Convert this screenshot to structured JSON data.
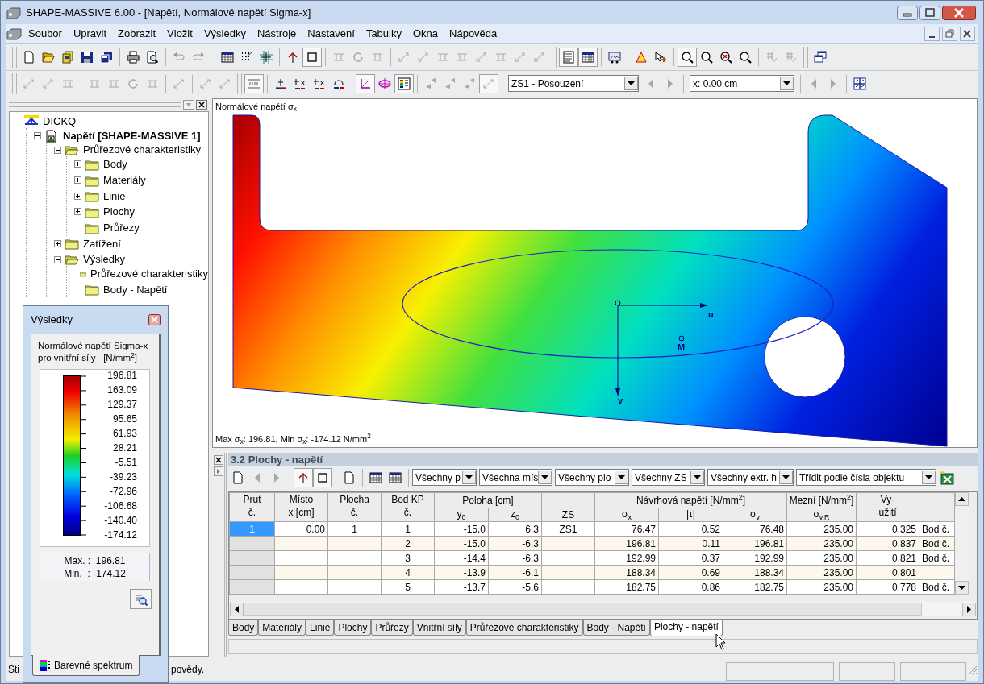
{
  "window": {
    "title": "SHAPE-MASSIVE 6.00 - [Napětí, Normálové napětí Sigma-x]"
  },
  "menu": [
    "Soubor",
    "Upravit",
    "Zobrazit",
    "Vložit",
    "Výsledky",
    "Nástroje",
    "Nastavení",
    "Tabulky",
    "Okna",
    "Nápověda"
  ],
  "toolbar": {
    "load_case": "ZS1 - Posouzení",
    "location": "x: 0.00 cm"
  },
  "navigator": {
    "tree": [
      {
        "label": "DICKQ",
        "kind": "root",
        "children": [
          {
            "label": "Napětí [SHAPE-MASSIVE 1]",
            "kind": "file",
            "expanded": true,
            "children": [
              {
                "label": "Průřezové charakteristiky",
                "kind": "folder",
                "expanded": true,
                "children": [
                  {
                    "label": "Body",
                    "kind": "folder",
                    "expanded": false
                  },
                  {
                    "label": "Materiály",
                    "kind": "folder",
                    "expanded": false
                  },
                  {
                    "label": "Linie",
                    "kind": "folder",
                    "expanded": false
                  },
                  {
                    "label": "Plochy",
                    "kind": "folder",
                    "expanded": false
                  },
                  {
                    "label": "Průřezy",
                    "kind": "leaf"
                  }
                ]
              },
              {
                "label": "Zatížení",
                "kind": "folder",
                "expanded": false
              },
              {
                "label": "Výsledky",
                "kind": "folder",
                "expanded": true,
                "children": [
                  {
                    "label": "Průřezové charakteristiky",
                    "kind": "leaf"
                  },
                  {
                    "label": "Body - Napětí",
                    "kind": "leaf"
                  }
                ]
              }
            ]
          }
        ]
      }
    ]
  },
  "graphic": {
    "title": "Normálové napětí σ$_{x}$",
    "axis_labels": [
      "u",
      "v"
    ],
    "point_label": "M",
    "summary": "Max σ$_{x}$: 196.81, Min σ$_{x}$: -174.12 N/mm$^{2}$"
  },
  "results_panel": {
    "title": "Výsledky",
    "caption": [
      "Normálové napětí Sigma-x",
      "pro vnitřní síly   [N/mm$^{2}$]"
    ],
    "scale": [
      "196.81",
      "163.09",
      "129.37",
      "95.65",
      "61.93",
      "28.21",
      "-5.51",
      "-39.23",
      "-72.96",
      "-106.68",
      "-140.40",
      "-174.12"
    ],
    "extremes": [
      "Max. :  196.81",
      "Min.  : -174.12"
    ],
    "tab": "Barevné spektrum"
  },
  "table_panel": {
    "title": "3.2 Plochy - napětí",
    "filters": [
      "Všechny p",
      "Všechna mís",
      "Všechny plo",
      "Všechny ZS",
      "Všechny extr. h",
      "Třídit podle čísla objektu"
    ],
    "columns": [
      {
        "kind": "stack",
        "lines": [
          "Prut",
          "č."
        ]
      },
      {
        "kind": "stack",
        "lines": [
          "Místo",
          "x [cm]"
        ]
      },
      {
        "kind": "stack",
        "lines": [
          "Plocha",
          "č."
        ]
      },
      {
        "kind": "stack",
        "lines": [
          "Bod KP",
          "č."
        ]
      },
      {
        "kind": "group",
        "title": "Poloha [cm]",
        "colspan": 2,
        "subs": [
          "y$_{0}$",
          "z$_{0}$"
        ]
      },
      {
        "kind": "single",
        "label": "ZS"
      },
      {
        "kind": "group",
        "title": "Návrhová napětí [N/mm$^{2}$]",
        "colspan": 3,
        "subs": [
          "σ$_{x}$",
          "|τ|",
          "σ$_{v}$"
        ]
      },
      {
        "kind": "group",
        "title": "Mezní [N/mm$^{2}$]",
        "subs": [
          "σ$_{v,R}$"
        ]
      },
      {
        "kind": "stack",
        "lines": [
          "Vy-",
          "užití"
        ]
      }
    ],
    "rows": [
      {
        "selected": true,
        "cells": [
          "1",
          "0.00",
          "1",
          "1",
          "-15.0",
          "6.3",
          "ZS1",
          "76.47",
          "0.52",
          "76.48",
          "235.00",
          "0.325",
          "Bod č."
        ]
      },
      {
        "selected": false,
        "cells": [
          null,
          null,
          null,
          "2",
          "-15.0",
          "-6.3",
          null,
          "196.81",
          "0.11",
          "196.81",
          "235.00",
          "0.837",
          "Bod č."
        ]
      },
      {
        "selected": false,
        "cells": [
          null,
          null,
          null,
          "3",
          "-14.4",
          "-6.3",
          null,
          "192.99",
          "0.37",
          "192.99",
          "235.00",
          "0.821",
          "Bod č."
        ]
      },
      {
        "selected": false,
        "cells": [
          null,
          null,
          null,
          "4",
          "-13.9",
          "-6.1",
          null,
          "188.34",
          "0.69",
          "188.34",
          "235.00",
          "0.801",
          null
        ]
      },
      {
        "selected": false,
        "cells": [
          null,
          null,
          null,
          "5",
          "-13.7",
          "-5.6",
          null,
          "182.75",
          "0.86",
          "182.75",
          "235.00",
          "0.778",
          "Bod č."
        ]
      }
    ],
    "tabs": [
      {
        "label": "Body",
        "selected": false
      },
      {
        "label": "Materiály",
        "selected": false
      },
      {
        "label": "Linie",
        "selected": false
      },
      {
        "label": "Plochy",
        "selected": false
      },
      {
        "label": "Průřezy",
        "selected": false
      },
      {
        "label": "Vnitřní síly",
        "selected": false
      },
      {
        "label": "Průřezové charakteristiky",
        "selected": false
      },
      {
        "label": "Body - Napětí",
        "selected": false
      },
      {
        "label": "Plochy - napětí",
        "selected": true
      }
    ]
  },
  "status_bar": [
    "Sti",
    "povědy."
  ]
}
